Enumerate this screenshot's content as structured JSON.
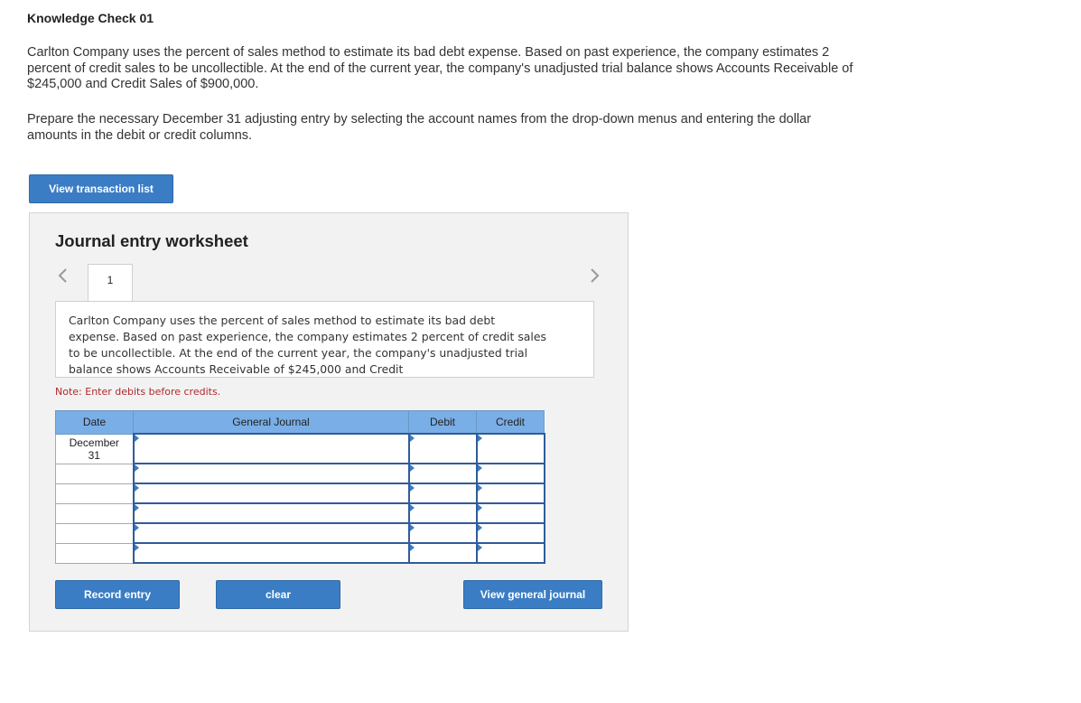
{
  "page": {
    "title": "Knowledge Check 01",
    "paragraph1": "Carlton Company uses the percent of sales method to estimate its bad debt expense. Based on past experience, the company estimates 2 percent of credit sales to be uncollectible. At the end of the current year, the company's unadjusted trial balance shows Accounts Receivable of $245,000 and Credit Sales of $900,000.",
    "paragraph2": "Prepare the necessary December 31 adjusting entry by selecting the account names from the drop-down menus and entering the dollar amounts in the debit or credit columns.",
    "view_transaction_list": "View transaction list"
  },
  "worksheet": {
    "title": "Journal entry worksheet",
    "tab_number": "1",
    "description": "Carlton Company uses the percent of sales method to estimate its bad debt expense. Based on past experience, the company estimates 2 percent of credit sales to be uncollectible. At the end of the current year, the company's unadjusted trial balance shows Accounts Receivable of $245,000 and Credit",
    "note": "Note: Enter debits before credits.",
    "table": {
      "headers": {
        "date": "Date",
        "journal": "General Journal",
        "debit": "Debit",
        "credit": "Credit"
      },
      "first_date": "December\n31"
    },
    "buttons": {
      "record": "Record entry",
      "clear": "clear",
      "view_general": "View general journal"
    }
  },
  "colors": {
    "button": "#3b7dc4",
    "header": "#7aaee6",
    "note": "#b0282b"
  }
}
